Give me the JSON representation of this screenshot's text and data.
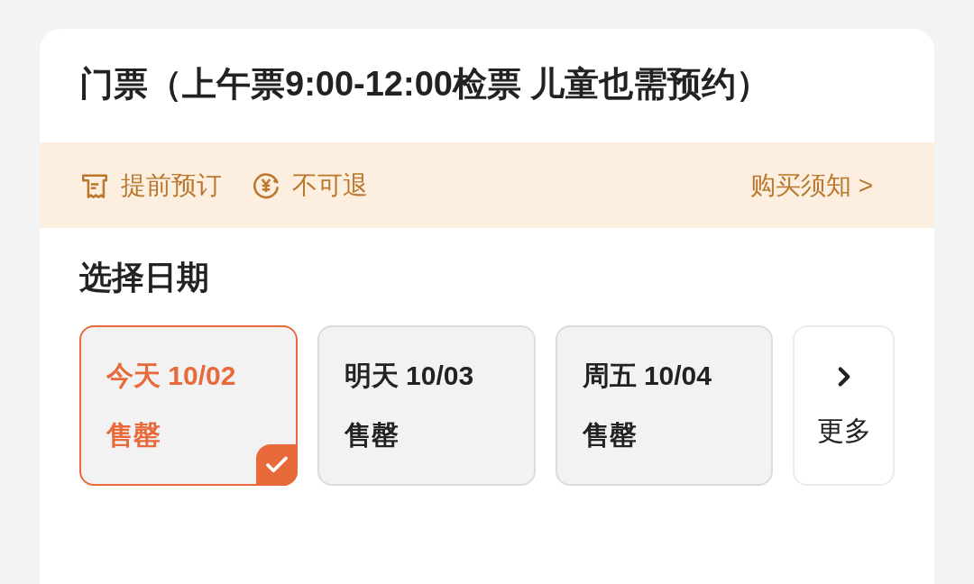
{
  "ticket": {
    "title": "门票（上午票9:00-12:00检票 儿童也需预约）"
  },
  "notices": [
    {
      "kind": "advance",
      "label": "提前预订"
    },
    {
      "kind": "refund",
      "label": "不可退"
    }
  ],
  "purchase_notes_link": "购买须知 >",
  "date_section": {
    "heading": "选择日期",
    "dates": [
      {
        "label": "今天 10/02",
        "status": "售罄",
        "selected": true
      },
      {
        "label": "明天 10/03",
        "status": "售罄",
        "selected": false
      },
      {
        "label": "周五 10/04",
        "status": "售罄",
        "selected": false
      }
    ],
    "more": "更多"
  }
}
